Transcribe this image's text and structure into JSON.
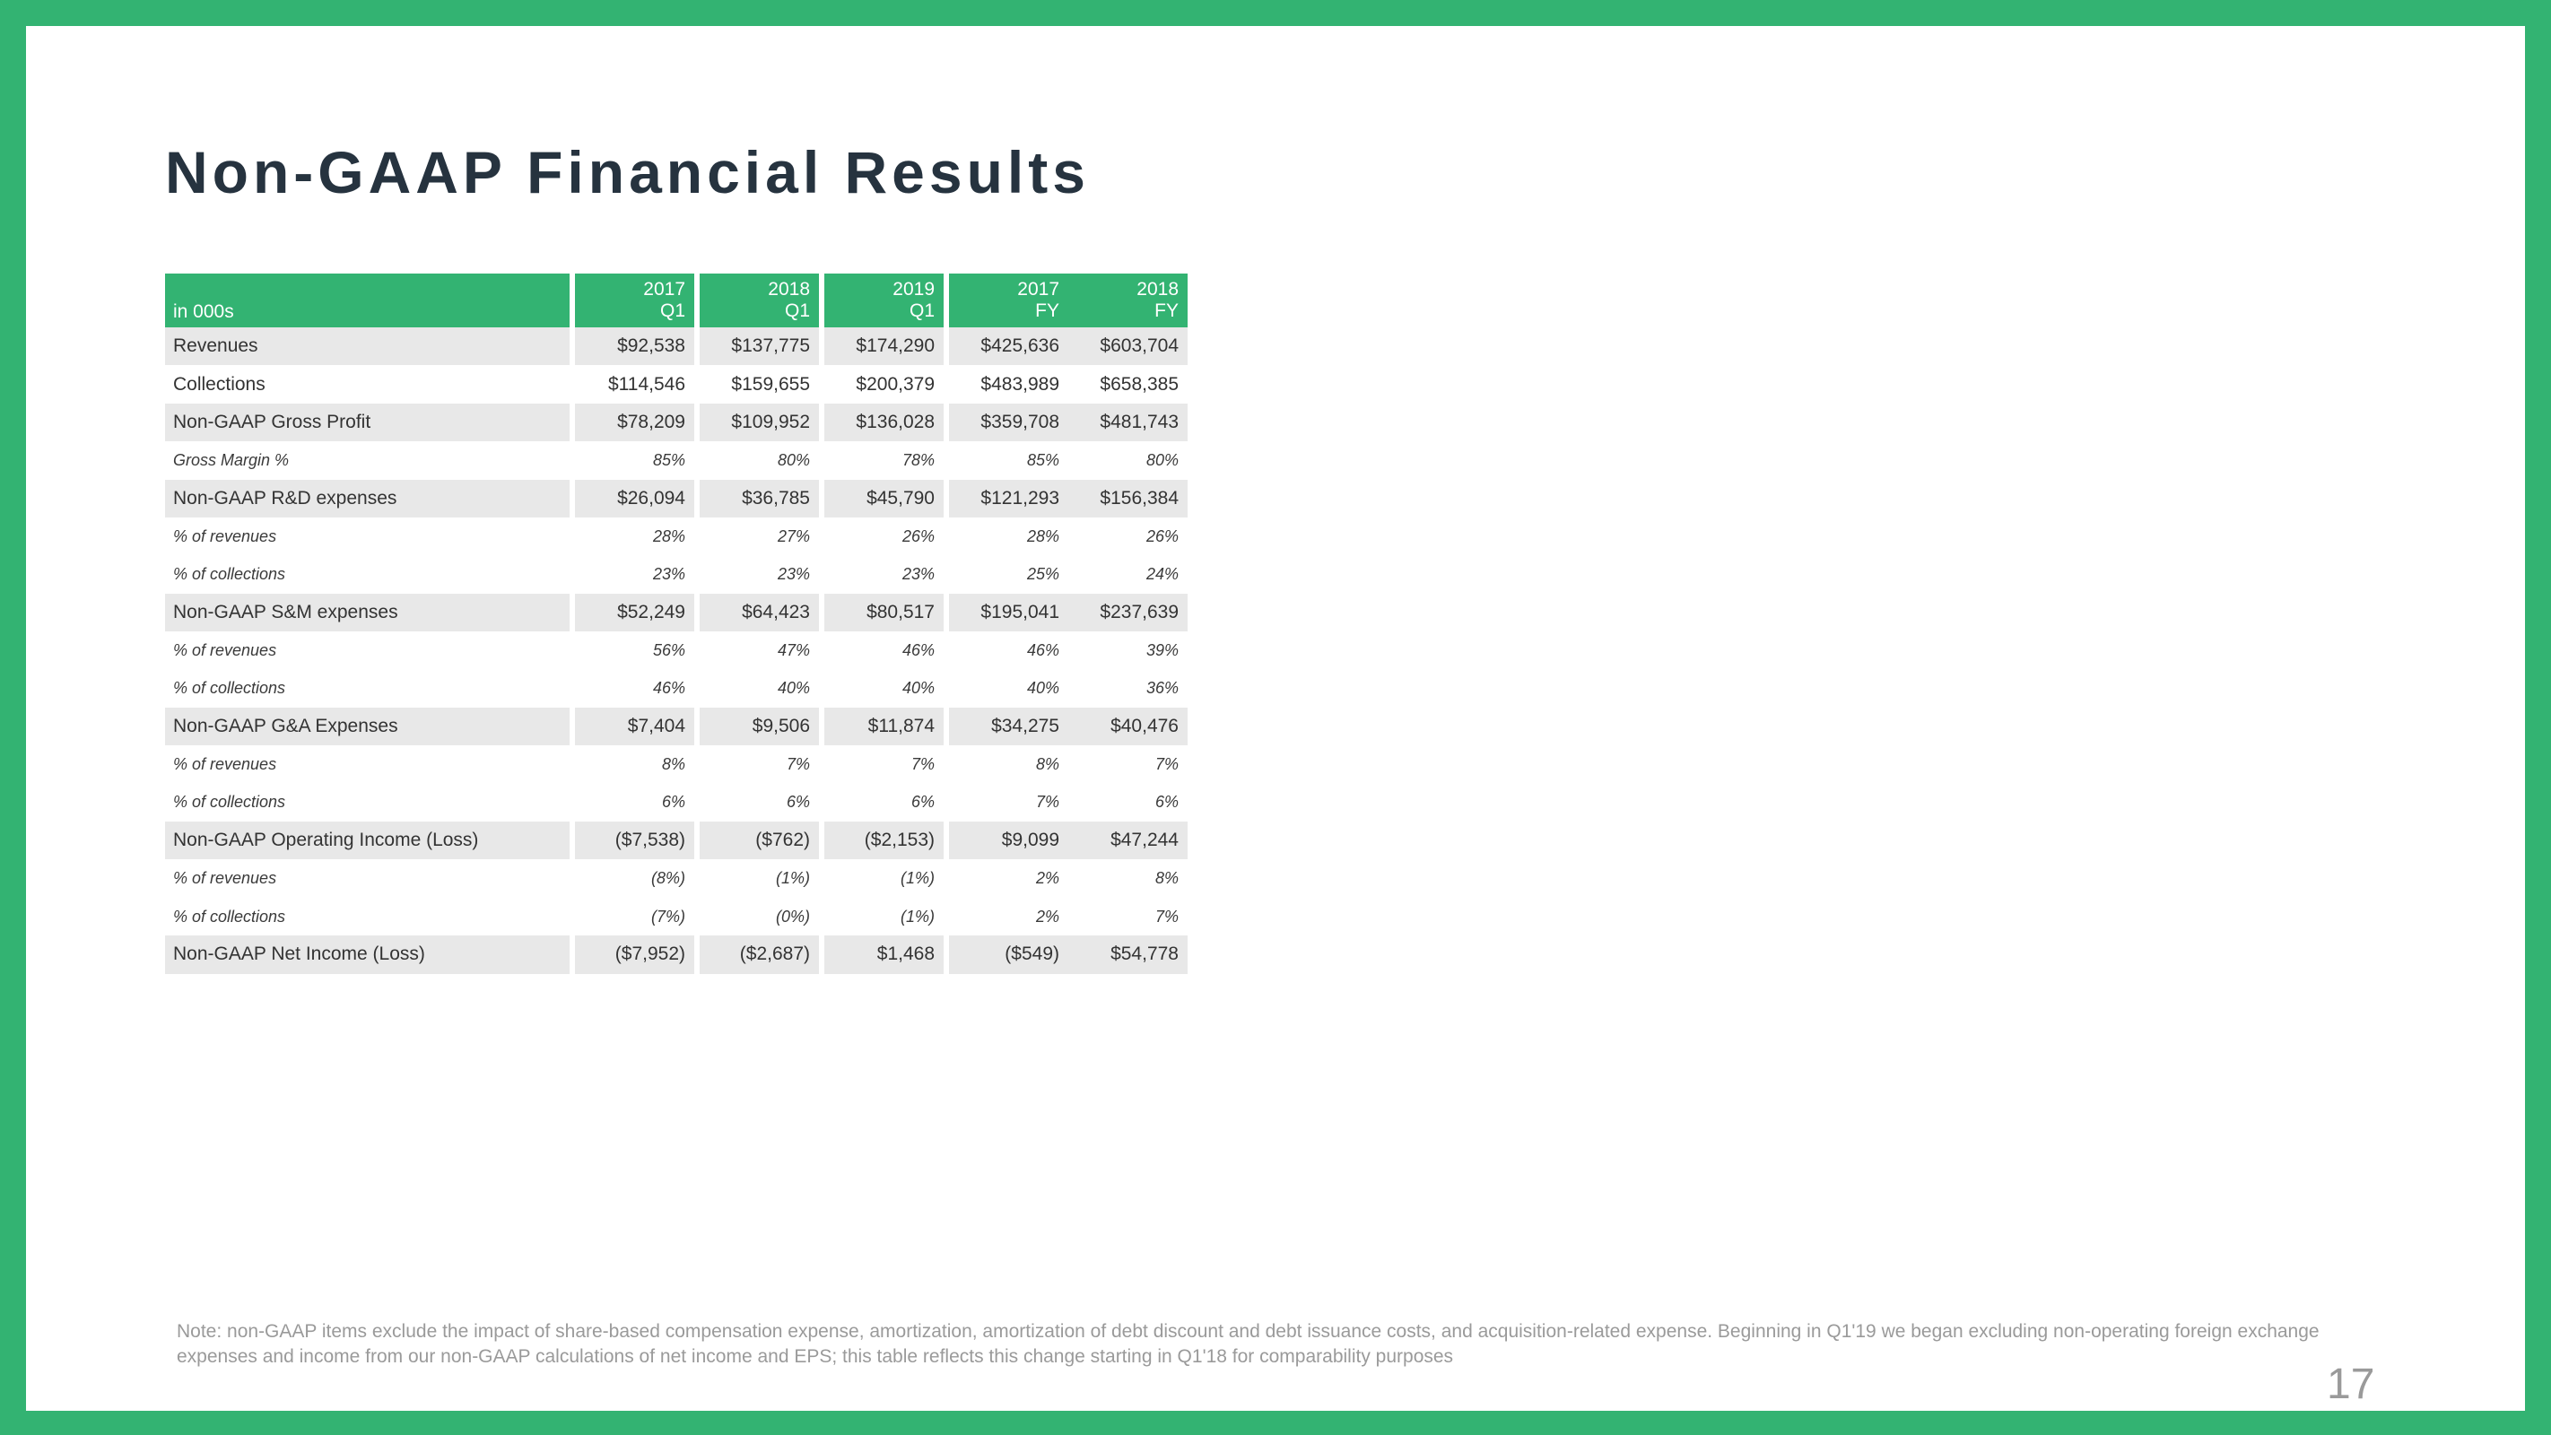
{
  "slide": {
    "title": "Non-GAAP Financial Results",
    "page_number": "17",
    "border_color": "#33b372",
    "title_color": "#26333f",
    "shade_color": "#e8e8e8",
    "footnote": "Note: non-GAAP items exclude the impact of share-based compensation expense, amortization, amortization of debt discount and debt issuance costs, and acquisition-related expense. Beginning in Q1'19 we began excluding non-operating foreign exchange expenses and income from our non-GAAP calculations of net income and EPS; this table reflects this change starting in Q1'18 for comparability purposes"
  },
  "table": {
    "corner_label": "in 000s",
    "columns": [
      {
        "year": "2017",
        "period": "Q1"
      },
      {
        "year": "2018",
        "period": "Q1"
      },
      {
        "year": "2019",
        "period": "Q1"
      },
      {
        "year": "2017",
        "period": "FY"
      },
      {
        "year": "2018",
        "period": "FY"
      }
    ],
    "rows": [
      {
        "label": "Revenues",
        "style": "main",
        "shaded": true,
        "values": [
          "$92,538",
          "$137,775",
          "$174,290",
          "$425,636",
          "$603,704"
        ]
      },
      {
        "label": "Collections",
        "style": "main",
        "shaded": false,
        "values": [
          "$114,546",
          "$159,655",
          "$200,379",
          "$483,989",
          "$658,385"
        ]
      },
      {
        "label": "Non-GAAP Gross Profit",
        "style": "main",
        "shaded": true,
        "values": [
          "$78,209",
          "$109,952",
          "$136,028",
          "$359,708",
          "$481,743"
        ]
      },
      {
        "label": "Gross Margin %",
        "style": "sub",
        "shaded": false,
        "values": [
          "85%",
          "80%",
          "78%",
          "85%",
          "80%"
        ]
      },
      {
        "label": "Non-GAAP R&D expenses",
        "style": "main",
        "shaded": true,
        "values": [
          "$26,094",
          "$36,785",
          "$45,790",
          "$121,293",
          "$156,384"
        ]
      },
      {
        "label": "% of revenues",
        "style": "sub",
        "shaded": false,
        "values": [
          "28%",
          "27%",
          "26%",
          "28%",
          "26%"
        ]
      },
      {
        "label": "% of collections",
        "style": "sub",
        "shaded": false,
        "values": [
          "23%",
          "23%",
          "23%",
          "25%",
          "24%"
        ]
      },
      {
        "label": "Non-GAAP S&M expenses",
        "style": "main",
        "shaded": true,
        "values": [
          "$52,249",
          "$64,423",
          "$80,517",
          "$195,041",
          "$237,639"
        ]
      },
      {
        "label": "% of revenues",
        "style": "sub",
        "shaded": false,
        "values": [
          "56%",
          "47%",
          "46%",
          "46%",
          "39%"
        ]
      },
      {
        "label": "% of collections",
        "style": "sub",
        "shaded": false,
        "values": [
          "46%",
          "40%",
          "40%",
          "40%",
          "36%"
        ]
      },
      {
        "label": "Non-GAAP G&A Expenses",
        "style": "main",
        "shaded": true,
        "values": [
          "$7,404",
          "$9,506",
          "$11,874",
          "$34,275",
          "$40,476"
        ]
      },
      {
        "label": "% of revenues",
        "style": "sub",
        "shaded": false,
        "values": [
          "8%",
          "7%",
          "7%",
          "8%",
          "7%"
        ]
      },
      {
        "label": "% of collections",
        "style": "sub",
        "shaded": false,
        "values": [
          "6%",
          "6%",
          "6%",
          "7%",
          "6%"
        ]
      },
      {
        "label": "Non-GAAP Operating Income (Loss)",
        "style": "main",
        "shaded": true,
        "values": [
          "($7,538)",
          "($762)",
          "($2,153)",
          "$9,099",
          "$47,244"
        ]
      },
      {
        "label": "% of revenues",
        "style": "sub",
        "shaded": false,
        "values": [
          "(8%)",
          "(1%)",
          "(1%)",
          "2%",
          "8%"
        ]
      },
      {
        "label": "% of collections",
        "style": "sub",
        "shaded": false,
        "values": [
          "(7%)",
          "(0%)",
          "(1%)",
          "2%",
          "7%"
        ]
      },
      {
        "label": "Non-GAAP Net Income (Loss)",
        "style": "main",
        "shaded": true,
        "values": [
          "($7,952)",
          "($2,687)",
          "$1,468",
          "($549)",
          "$54,778"
        ]
      }
    ]
  }
}
